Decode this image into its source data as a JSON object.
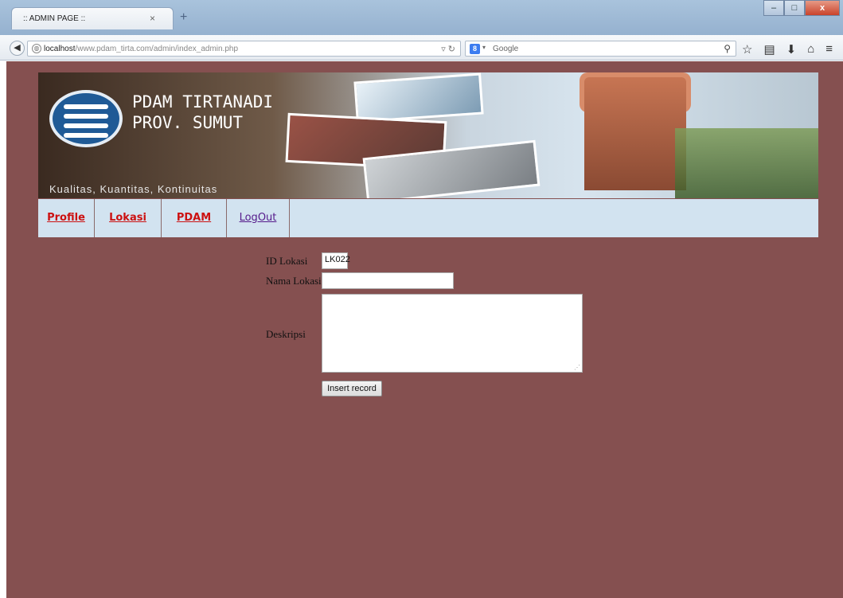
{
  "browser": {
    "tab_title": ":: ADMIN PAGE ::",
    "tab_close": "×",
    "new_tab": "+",
    "url_host": "localhost",
    "url_path": "/www.pdam_tirta.com/admin/index_admin.php",
    "search_placeholder": "Google",
    "window_buttons": {
      "minimize": "–",
      "maximize": "□",
      "close": "x"
    }
  },
  "banner": {
    "title_line1": "PDAM TIRTANADI",
    "title_line2": "PROV. SUMUT",
    "tagline": "Kualitas, Kuantitas, Kontinuitas"
  },
  "menu": {
    "items": [
      {
        "label": "Profile"
      },
      {
        "label": "Lokasi"
      },
      {
        "label": "PDAM"
      },
      {
        "label": "LogOut"
      }
    ]
  },
  "form": {
    "id_label": "ID Lokasi",
    "id_value": "LK022",
    "nama_label": "Nama Lokasi",
    "nama_value": "",
    "deskripsi_label": "Deskripsi",
    "deskripsi_value": "",
    "submit_label": "Insert record"
  },
  "colors": {
    "page_background": "#855050",
    "menu_background": "#d2e3f0",
    "menu_link": "#cc1111",
    "menu_visited": "#551a8b"
  }
}
